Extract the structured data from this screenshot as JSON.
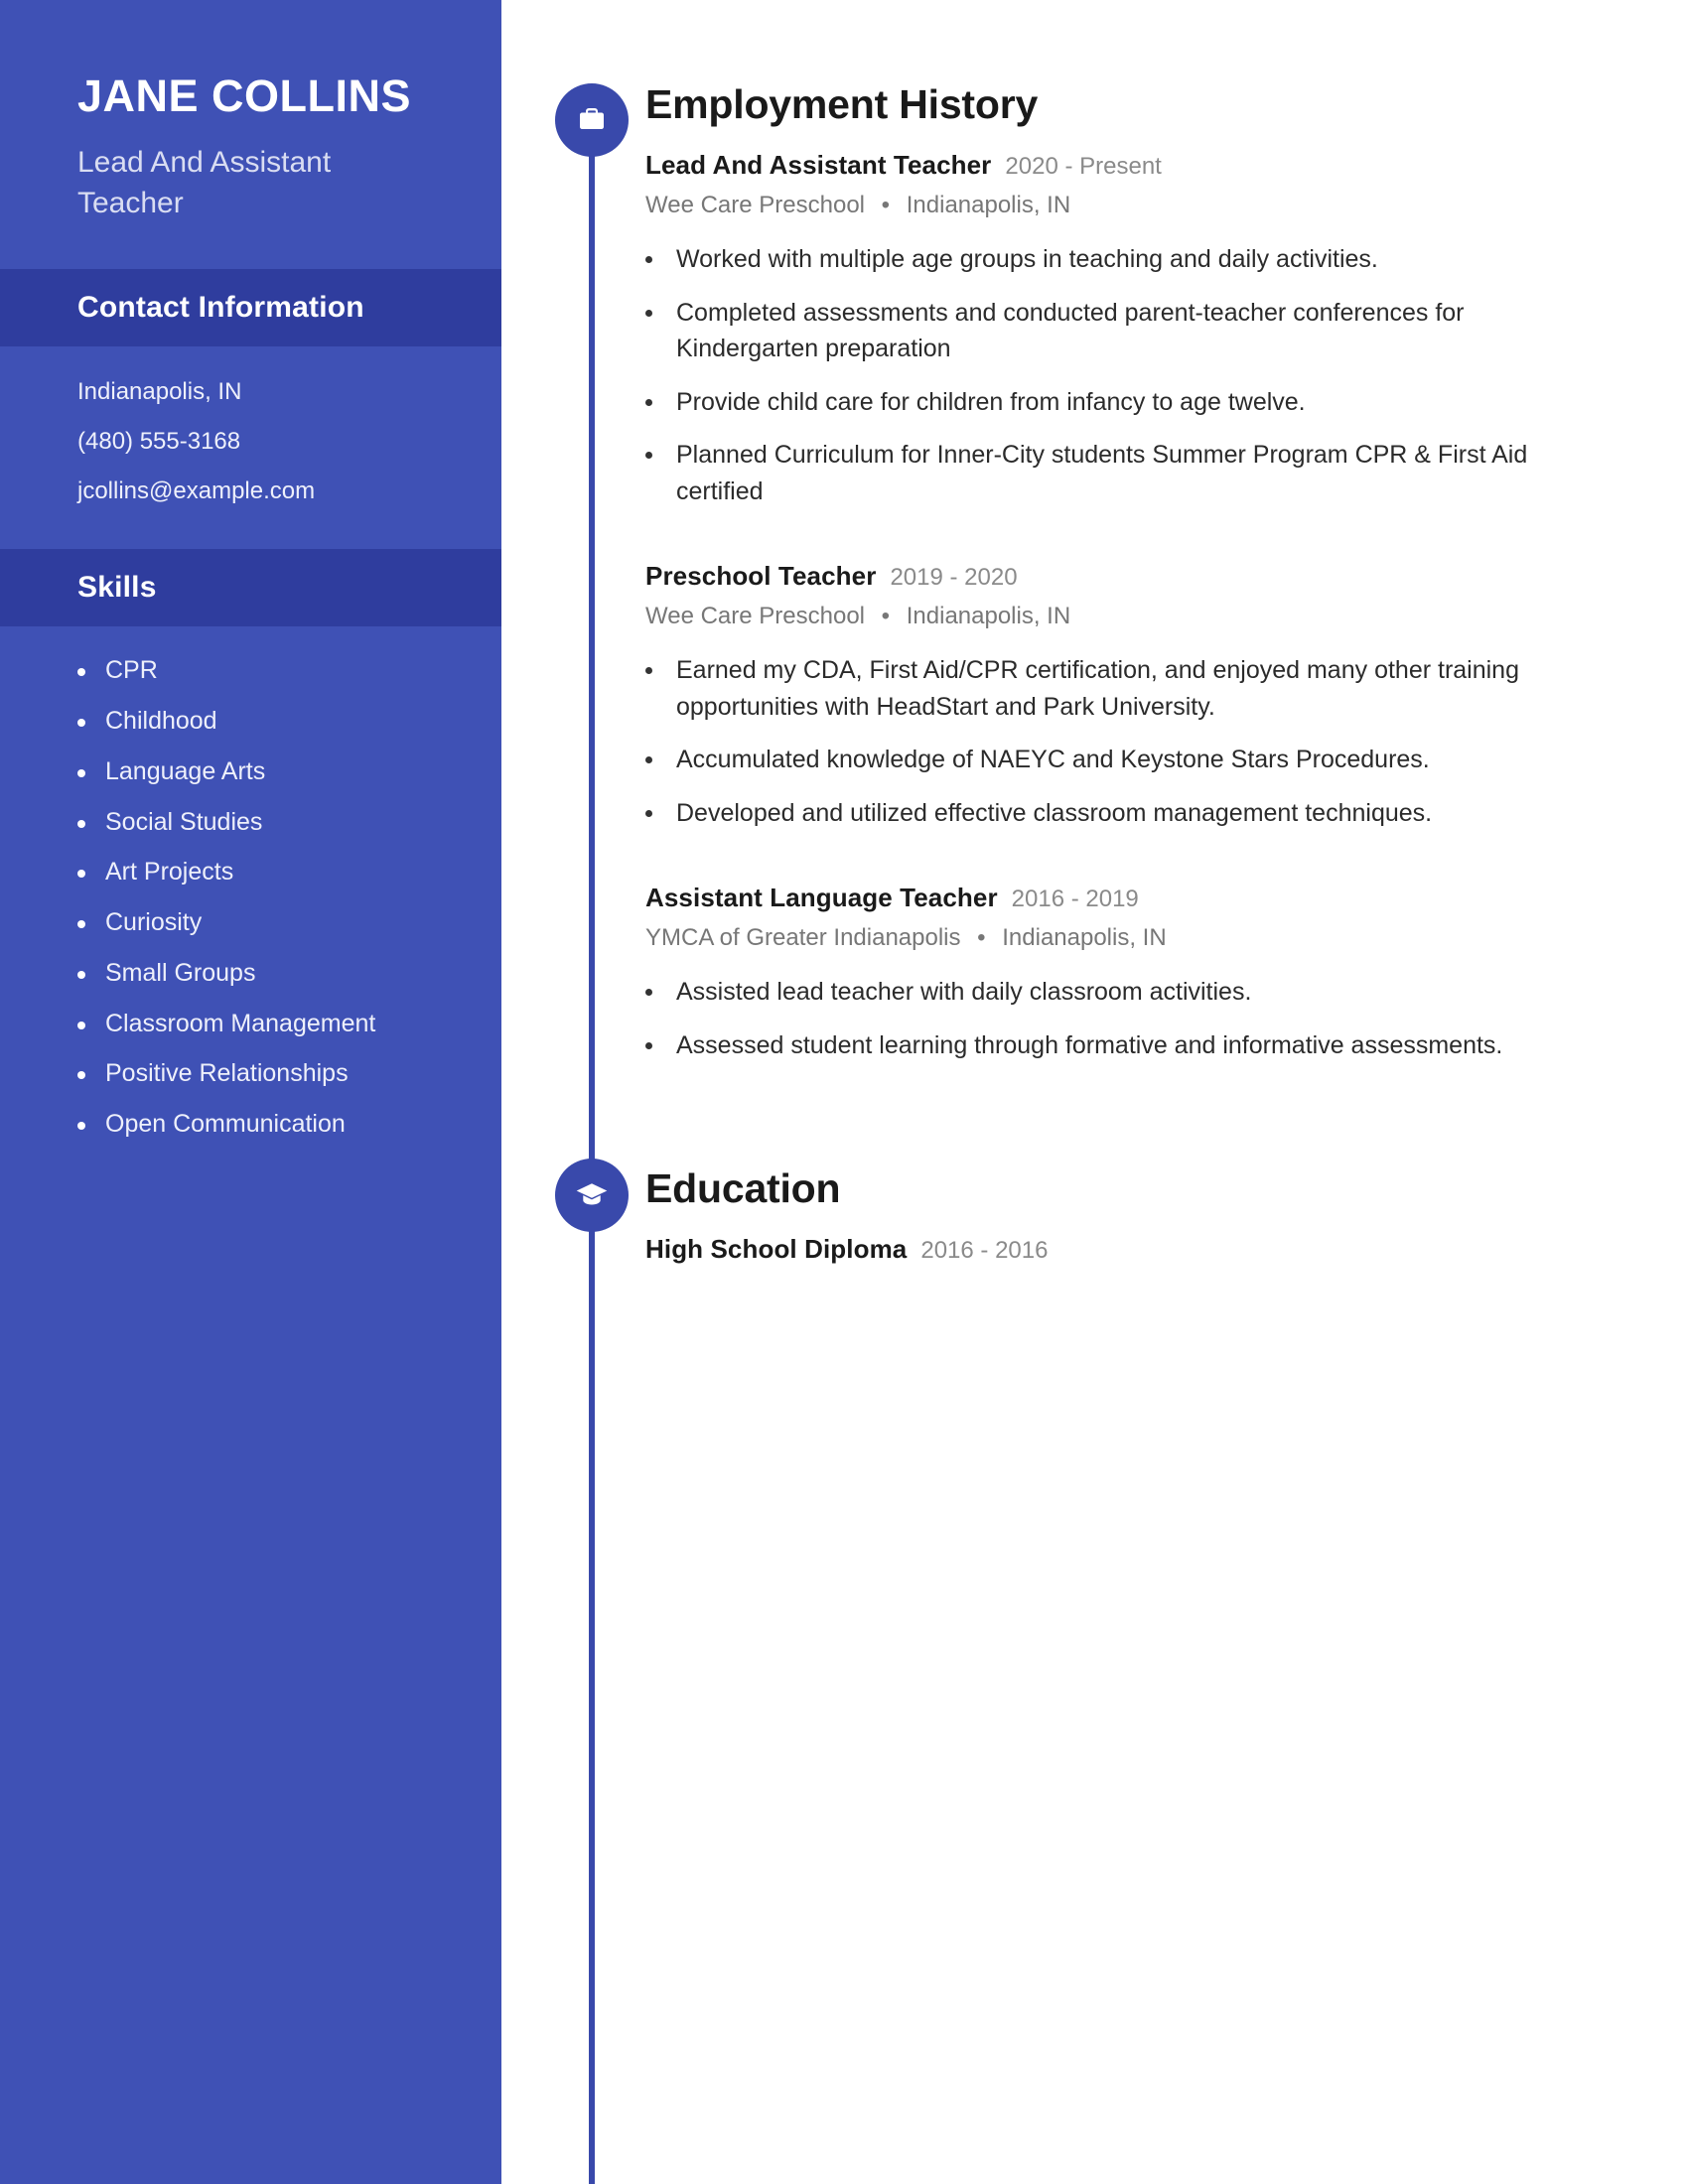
{
  "colors": {
    "sidebar_bg": "#3f51b5",
    "sidebar_band_bg": "#2f3d9e",
    "timeline": "#3949ab",
    "heading_text": "#1a1a1a",
    "muted_text": "#8a8a8a"
  },
  "sidebar": {
    "name": "JANE COLLINS",
    "job_title": "Lead And Assistant Teacher",
    "contact_section_title": "Contact Information",
    "contact": [
      "Indianapolis, IN",
      "(480) 555-3168",
      "jcollins@example.com"
    ],
    "skills_section_title": "Skills",
    "skills": [
      "CPR",
      "Childhood",
      "Language Arts",
      "Social Studies",
      "Art Projects",
      "Curiosity",
      "Small Groups",
      "Classroom Management",
      "Positive Relationships",
      "Open Communication"
    ]
  },
  "main": {
    "employment": {
      "section_title": "Employment History",
      "icon": "briefcase-icon",
      "entries": [
        {
          "role": "Lead And Assistant Teacher",
          "dates": "2020 - Present",
          "company": "Wee Care Preschool",
          "location": "Indianapolis, IN",
          "bullets": [
            "Worked with multiple age groups in teaching and daily activities.",
            "Completed assessments and conducted parent-teacher conferences for Kindergarten preparation",
            "Provide child care for children from infancy to age twelve.",
            "Planned Curriculum for Inner-City students Summer Program CPR & First Aid certified"
          ]
        },
        {
          "role": "Preschool Teacher",
          "dates": "2019 - 2020",
          "company": "Wee Care Preschool",
          "location": "Indianapolis, IN",
          "bullets": [
            "Earned my CDA, First Aid/CPR certification, and enjoyed many other training opportunities with HeadStart and Park University.",
            "Accumulated knowledge of NAEYC and Keystone Stars Procedures.",
            "Developed and utilized effective classroom management techniques."
          ]
        },
        {
          "role": "Assistant Language Teacher",
          "dates": "2016 - 2019",
          "company": "YMCA of Greater Indianapolis",
          "location": "Indianapolis, IN",
          "bullets": [
            "Assisted lead teacher with daily classroom activities.",
            "Assessed student learning through formative and informative assessments."
          ]
        }
      ]
    },
    "education": {
      "section_title": "Education",
      "icon": "graduation-cap-icon",
      "entries": [
        {
          "role": "High School Diploma",
          "dates": "2016 - 2016"
        }
      ]
    }
  },
  "separator_dot": "•"
}
